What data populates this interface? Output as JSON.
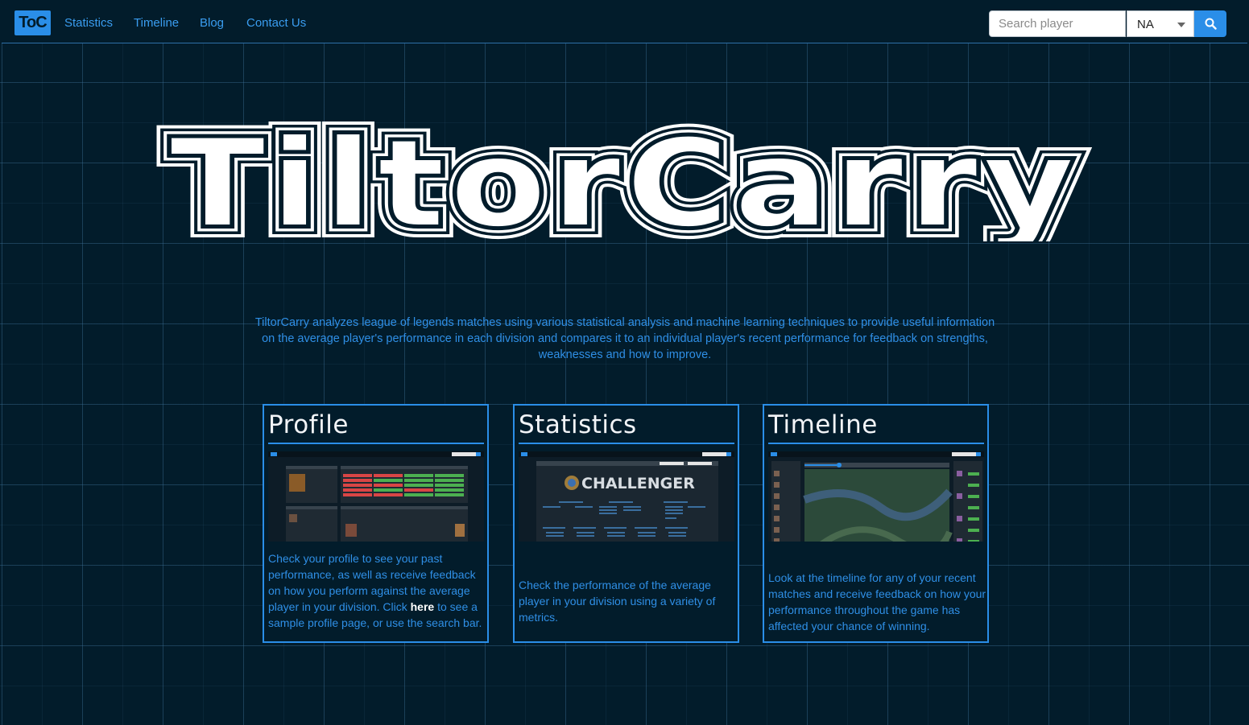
{
  "navbar": {
    "brand": "ToC",
    "links": [
      "Statistics",
      "Timeline",
      "Blog",
      "Contact Us"
    ],
    "search_placeholder": "Search player",
    "region": "NA",
    "search_icon": "search-icon"
  },
  "hero": {
    "title": "TiltorCarry",
    "description": "TiltorCarry analyzes league of legends matches using various statistical analysis and machine learning techniques to provide useful information on the average player's performance in each division and compares it to an individual player's recent performance for feedback on strengths, weaknesses and how to improve."
  },
  "cards": [
    {
      "title": "Profile",
      "text_before": "Check your profile to see your past performance, as well as receive feedback on how you perform against the average player in your division. Click ",
      "link": "here",
      "text_after": " to see a sample profile page, or use the search bar."
    },
    {
      "title": "Statistics",
      "thumb_banner": "CHALLENGER",
      "text": "Check the performance of the average player in your division using a variety of metrics."
    },
    {
      "title": "Timeline",
      "text": "Look at the timeline for any of your recent matches and receive feedback on how your performance throughout the game has affected your chance of winning."
    }
  ],
  "colors": {
    "background": "#021c2b",
    "accent": "#2a8ee8",
    "text_blue": "#2f8fe6",
    "title_white": "#ffffff"
  }
}
